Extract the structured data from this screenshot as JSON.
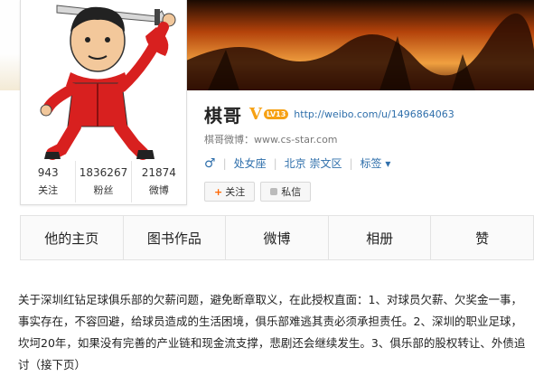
{
  "profile": {
    "name": "棋哥",
    "verified_mark": "V",
    "level": "LV13",
    "url": "http://weibo.com/u/1496864063",
    "blog": "棋哥微博：www.cs-star.com",
    "gender_icon": "male-icon",
    "zodiac": "处女座",
    "location": "北京 崇文区",
    "tags_label": "标签",
    "follow_label": "关注",
    "message_label": "私信"
  },
  "stats": [
    {
      "value": "943",
      "label": "关注"
    },
    {
      "value": "1836267",
      "label": "粉丝"
    },
    {
      "value": "21874",
      "label": "微博"
    }
  ],
  "tabs": [
    "他的主页",
    "图书作品",
    "微博",
    "相册",
    "赞"
  ],
  "post": {
    "text": "关于深圳红钻足球俱乐部的欠薪问题，避免断章取义，在此授权直面：1、对球员欠薪、欠奖金一事，事实存在，不容回避，给球员造成的生活困境，俱乐部难逃其责必须承担责任。2、深圳的职业足球，坎坷20年，如果没有完善的产业链和现金流支撑，悲剧还会继续发生。3、俱乐部的股权转让、外债追讨（接下页）"
  },
  "colors": {
    "link": "#2f6fab",
    "verified": "#f6a114"
  }
}
